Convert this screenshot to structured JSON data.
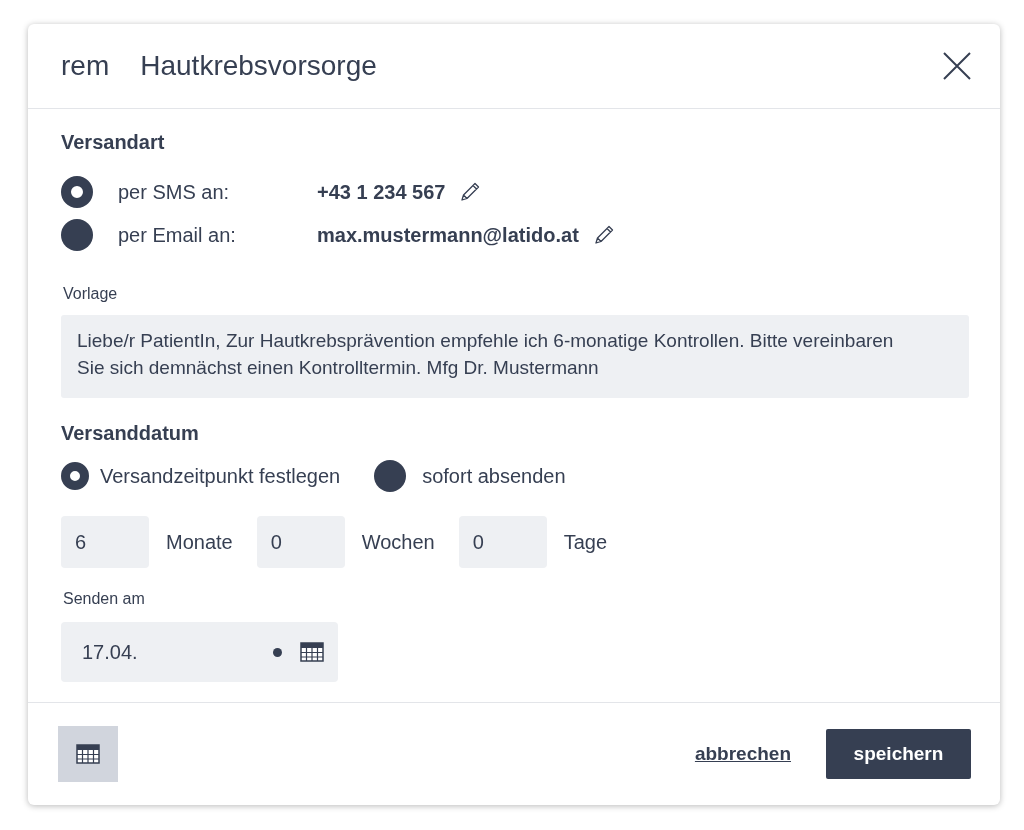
{
  "dialog": {
    "prefix": "rem",
    "title": "Hautkrebsvorsorge"
  },
  "versandart": {
    "heading": "Versandart",
    "options": [
      {
        "label": "per SMS an:",
        "value": "+43 1 234 567",
        "selected": true
      },
      {
        "label": "per Email an:",
        "value": "max.mustermann@latido.at",
        "selected": false
      }
    ]
  },
  "vorlage": {
    "label": "Vorlage",
    "text": "Liebe/r PatientIn, Zur Hautkrebsprävention empfehle ich 6-monatige Kontrollen. Bitte vereinbaren Sie sich demnächst einen Kontrolltermin. Mfg Dr. Mustermann"
  },
  "versanddatum": {
    "heading": "Versanddatum",
    "options": [
      {
        "label": "Versandzeitpunkt festlegen",
        "selected": true
      },
      {
        "label": "sofort absenden",
        "selected": false
      }
    ],
    "intervals": [
      {
        "value": "6",
        "unit": "Monate"
      },
      {
        "value": "0",
        "unit": "Wochen"
      },
      {
        "value": "0",
        "unit": "Tage"
      }
    ]
  },
  "senden_am": {
    "label": "Senden am",
    "value": "17.04."
  },
  "footer": {
    "cancel": "abbrechen",
    "save": "speichern"
  }
}
